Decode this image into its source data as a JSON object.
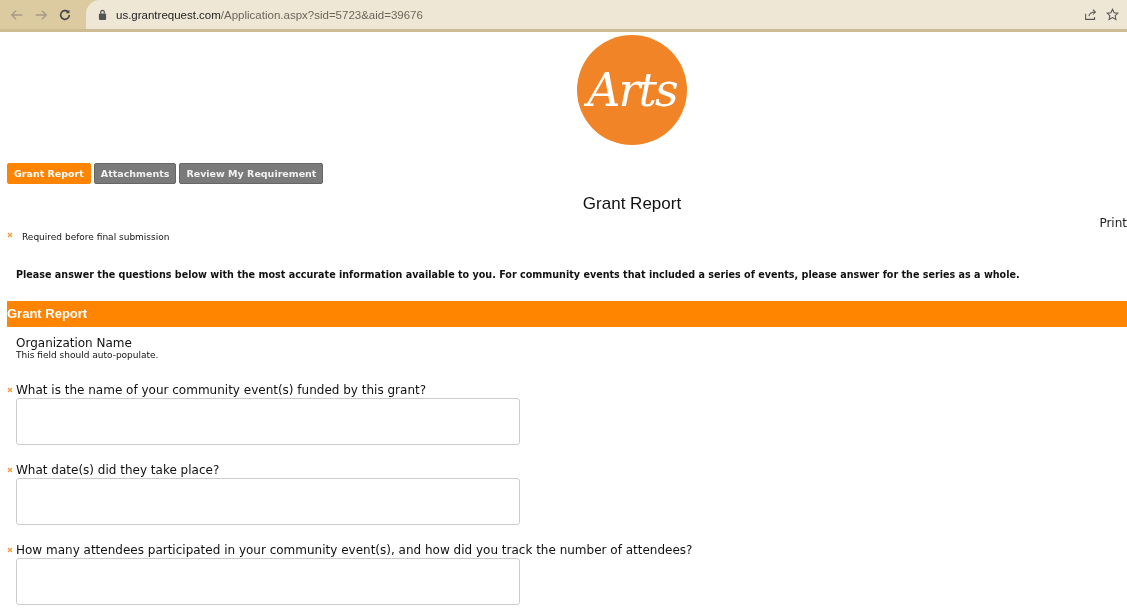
{
  "browser": {
    "url_host": "us.grantrequest.com",
    "url_path": "/Application.aspx?sid=5723&aid=39676"
  },
  "logo": {
    "text": "Arts"
  },
  "tabs": [
    {
      "label": "Grant Report",
      "selected": true
    },
    {
      "label": "Attachments",
      "selected": false
    },
    {
      "label": "Review My Requirement",
      "selected": false
    }
  ],
  "page_title": "Grant Report",
  "print_link": "Print",
  "required_legend": "Required before final submission",
  "instructions": "Please answer the questions below with the most accurate information available to you. For community events that included a series of events, please answer for the series as a whole.",
  "section": {
    "title": "Grant Report",
    "fields": [
      {
        "kind": "static",
        "label": "Organization Name",
        "hint": "This field should auto-populate."
      },
      {
        "kind": "textarea",
        "label": "What is the name of your community event(s) funded by this grant?",
        "required": true
      },
      {
        "kind": "textarea",
        "label": "What date(s) did they take place?",
        "required": true
      },
      {
        "kind": "textarea",
        "label": "How many attendees participated in your community event(s), and how did you track the number of attendees?",
        "required": true
      }
    ]
  }
}
